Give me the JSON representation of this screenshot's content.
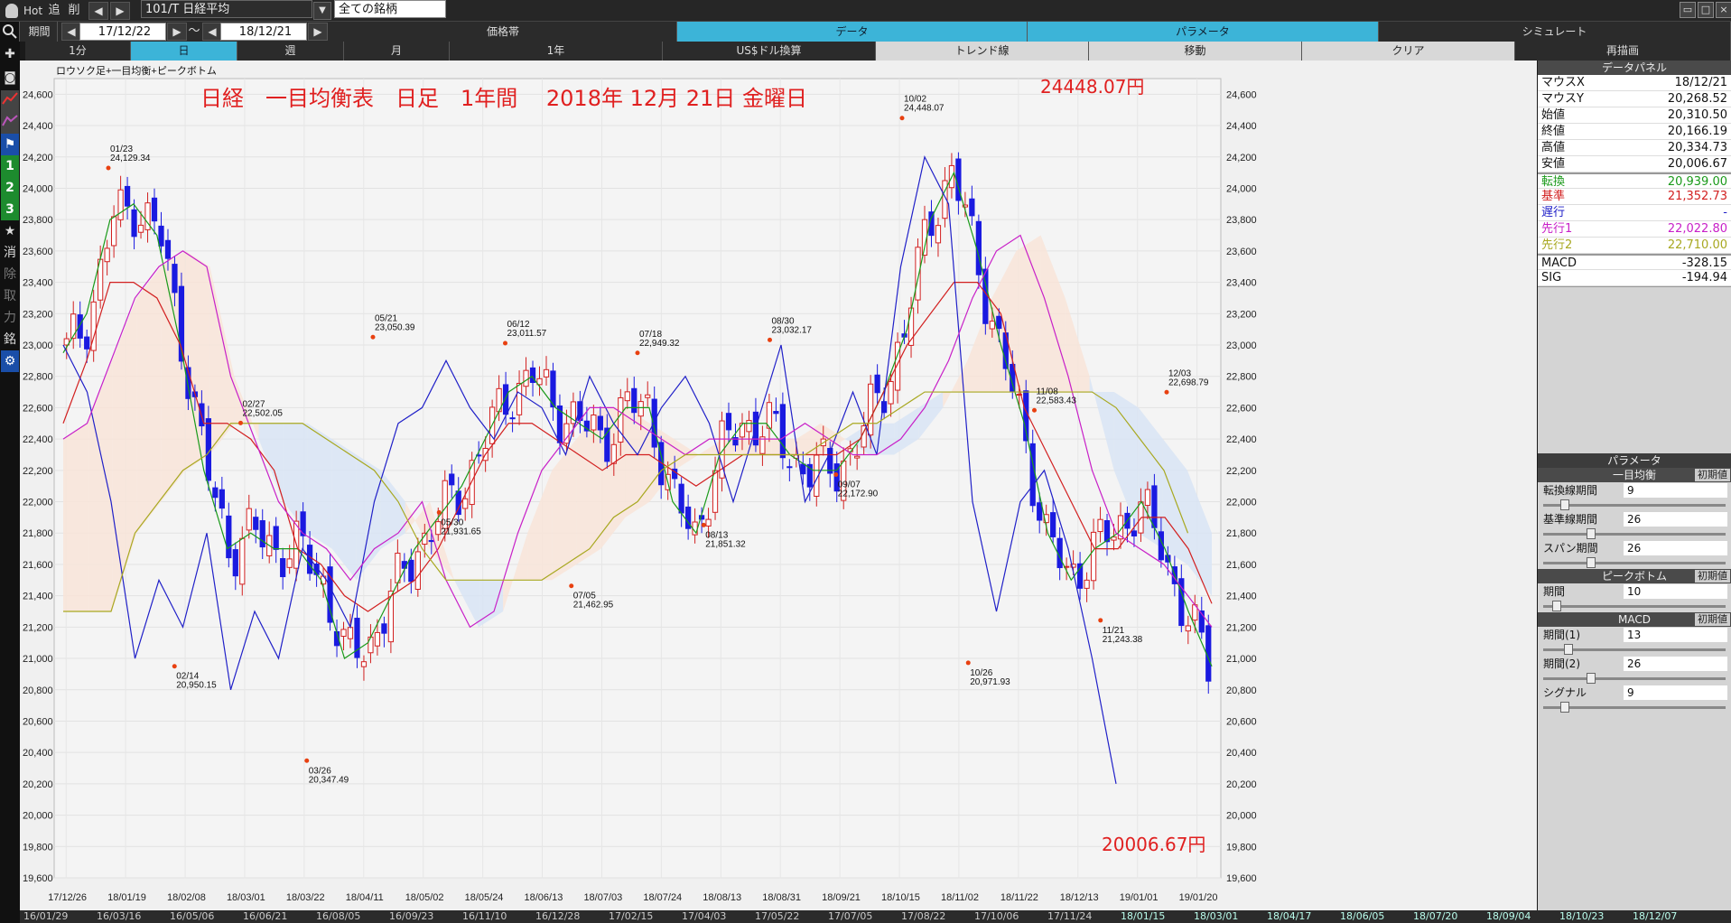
{
  "toolbar": {
    "hot": "Hot",
    "btn_tsui": "追",
    "btn_sakujo": "削",
    "symbol": "101/T 日経平均",
    "universe": "全ての銘柄"
  },
  "row2": {
    "period_label": "期間",
    "date_from": "17/12/22",
    "tilde": "～",
    "date_to": "18/12/21",
    "tabs": [
      "価格帯",
      "データ",
      "パラメータ",
      "シミュレート"
    ]
  },
  "row3": {
    "buttons": [
      "1分",
      "日",
      "週",
      "月",
      "1年",
      "US$ドル換算",
      "トレンド線",
      "移動",
      "クリア",
      "再描画"
    ]
  },
  "leftbar": {
    "items": [
      "消",
      "除",
      "取",
      "力",
      "銘"
    ]
  },
  "chart": {
    "legend": "ロウソク足+一目均衡+ピークボトム",
    "title": "日経　一目均衡表　日足　1年間　 2018年 12月 21日 金曜日",
    "high_label": "24448.07円",
    "low_label": "20006.67円"
  },
  "chart_data": {
    "type": "line",
    "title": "日経　一目均衡表　日足　1年間　 2018年 12月 21日 金曜日",
    "legend": [
      "ロウソク足",
      "一目均衡",
      "ピークボトム"
    ],
    "ylim": [
      19600,
      24700
    ],
    "yticks": [
      19600,
      19800,
      20000,
      20200,
      20400,
      20600,
      20800,
      21000,
      21200,
      21400,
      21600,
      21800,
      22000,
      22200,
      22400,
      22600,
      22800,
      23000,
      23200,
      23400,
      23600,
      23800,
      24000,
      24200,
      24400,
      24600
    ],
    "xticks": [
      "17/12/26",
      "18/01/19",
      "18/02/08",
      "18/03/01",
      "18/03/22",
      "18/04/11",
      "18/05/02",
      "18/05/24",
      "18/06/13",
      "18/07/03",
      "18/07/24",
      "18/08/13",
      "18/08/31",
      "18/09/21",
      "18/10/15",
      "18/11/02",
      "18/11/22",
      "18/12/13",
      "19/01/01",
      "19/01/20"
    ],
    "bottom_ticks": [
      "16/01/29",
      "16/03/16",
      "16/05/06",
      "16/06/21",
      "16/08/05",
      "16/09/23",
      "16/11/10",
      "16/12/28",
      "17/02/15",
      "17/04/03",
      "17/05/22",
      "17/07/05",
      "17/08/22",
      "17/10/06",
      "17/11/24",
      "18/01/15",
      "18/03/01",
      "18/04/17",
      "18/06/05",
      "18/07/20",
      "18/09/04",
      "18/10/23",
      "18/12/07"
    ],
    "grid": true,
    "peaks": [
      {
        "date": "01/23",
        "value": 24129.34,
        "type": "peak"
      },
      {
        "date": "02/14",
        "value": 20950.15,
        "type": "bottom"
      },
      {
        "date": "02/27",
        "value": 22502.05,
        "type": "peak"
      },
      {
        "date": "03/26",
        "value": 20347.49,
        "type": "bottom"
      },
      {
        "date": "05/21",
        "value": 23050.39,
        "type": "peak"
      },
      {
        "date": "05/30",
        "value": 21931.65,
        "type": "bottom"
      },
      {
        "date": "06/12",
        "value": 23011.57,
        "type": "peak"
      },
      {
        "date": "07/05",
        "value": 21462.95,
        "type": "bottom"
      },
      {
        "date": "07/18",
        "value": 22949.32,
        "type": "peak"
      },
      {
        "date": "08/13",
        "value": 21851.32,
        "type": "bottom"
      },
      {
        "date": "08/30",
        "value": 23032.17,
        "type": "peak"
      },
      {
        "date": "09/07",
        "value": 22172.9,
        "type": "bottom"
      },
      {
        "date": "10/02",
        "value": 24448.07,
        "type": "peak"
      },
      {
        "date": "10/26",
        "value": 20971.93,
        "type": "bottom"
      },
      {
        "date": "11/08",
        "value": 22583.43,
        "type": "peak"
      },
      {
        "date": "11/21",
        "value": 21243.38,
        "type": "bottom"
      },
      {
        "date": "12/03",
        "value": 22698.79,
        "type": "peak"
      }
    ],
    "series": [
      {
        "name": "転換",
        "color": "#1a9a1a",
        "values": [
          22950,
          23200,
          23800,
          23900,
          23700,
          23000,
          22200,
          21700,
          21800,
          21700,
          21700,
          21500,
          21000,
          21100,
          21400,
          21700,
          21900,
          22100,
          22400,
          22700,
          22800,
          22600,
          22500,
          22400,
          22600,
          22600,
          22000,
          21800,
          22300,
          22500,
          22500,
          22300,
          22200,
          22200,
          22400,
          22700,
          23100,
          23800,
          24100,
          23600,
          23000,
          22500,
          21800,
          21500,
          21700,
          21800,
          22000,
          21700,
          21300,
          20950
        ]
      },
      {
        "name": "基準",
        "color": "#d22020",
        "values": [
          22500,
          22900,
          23400,
          23400,
          23300,
          23000,
          22500,
          22500,
          22400,
          22200,
          21700,
          21600,
          21400,
          21300,
          21400,
          21500,
          21700,
          22000,
          22300,
          22500,
          22500,
          22400,
          22300,
          22200,
          22300,
          22300,
          22200,
          22100,
          22200,
          22300,
          22300,
          22300,
          22300,
          22300,
          22400,
          22700,
          23000,
          23200,
          23400,
          23400,
          23200,
          22600,
          22300,
          22000,
          21700,
          21700,
          21900,
          21900,
          21700,
          21350
        ]
      },
      {
        "name": "遅行",
        "color": "#2020c8",
        "values": [
          23000,
          22700,
          22000,
          21000,
          21500,
          21200,
          21800,
          20800,
          21300,
          21000,
          21700,
          21500,
          21200,
          22000,
          22500,
          22600,
          22900,
          22600,
          22400,
          22700,
          22600,
          22300,
          22800,
          22500,
          22300,
          22600,
          22800,
          22500,
          22000,
          22500,
          23000,
          22000,
          22300,
          22700,
          22300,
          23500,
          24200,
          23900,
          22000,
          21300,
          22000,
          22200,
          21700,
          21000,
          20200
        ]
      },
      {
        "name": "先行1",
        "color": "#c820c8",
        "values": [
          22400,
          22500,
          22900,
          23300,
          23500,
          23600,
          23500,
          22800,
          22400,
          22000,
          21800,
          21700,
          21500,
          21700,
          21800,
          22000,
          21500,
          21200,
          21300,
          21800,
          22200,
          22400,
          22600,
          22600,
          22500,
          22400,
          22300,
          22400,
          22400,
          22400,
          22400,
          22500,
          22400,
          22300,
          22300,
          22400,
          22600,
          22900,
          23300,
          23600,
          23700,
          23300,
          22800,
          22200,
          21800,
          21700,
          21600,
          21400,
          21200
        ]
      },
      {
        "name": "先行2",
        "color": "#a8a820",
        "values": [
          21300,
          21300,
          21300,
          21800,
          22000,
          22200,
          22300,
          22500,
          22500,
          22500,
          22500,
          22400,
          22300,
          22200,
          22000,
          21700,
          21500,
          21500,
          21500,
          21500,
          21500,
          21600,
          21700,
          21900,
          22000,
          22200,
          22300,
          22300,
          22300,
          22300,
          22300,
          22300,
          22400,
          22500,
          22500,
          22600,
          22700,
          22700,
          22700,
          22700,
          22700,
          22700,
          22700,
          22700,
          22600,
          22400,
          22200,
          21800
        ]
      }
    ]
  },
  "data_panel": {
    "title": "データパネル",
    "rows": [
      {
        "k": "マウスX",
        "v": "18/12/21",
        "color": "#111111"
      },
      {
        "k": "マウスY",
        "v": "20,268.52",
        "color": "#111111"
      },
      {
        "k": "始値",
        "v": "20,310.50",
        "color": "#111111"
      },
      {
        "k": "終値",
        "v": "20,166.19",
        "color": "#111111"
      },
      {
        "k": "高値",
        "v": "20,334.73",
        "color": "#111111"
      },
      {
        "k": "安値",
        "v": "20,006.67",
        "color": "#111111"
      },
      {
        "k": "転換",
        "v": "20,939.00",
        "color": "#1a9a1a"
      },
      {
        "k": "基準",
        "v": "21,352.73",
        "color": "#d22020"
      },
      {
        "k": "遅行",
        "v": "-",
        "color": "#2020c8"
      },
      {
        "k": "先行1",
        "v": "22,022.80",
        "color": "#c820c8"
      },
      {
        "k": "先行2",
        "v": "22,710.00",
        "color": "#a8a820"
      },
      {
        "k": "MACD",
        "v": "-328.15",
        "color": "#111111"
      },
      {
        "k": "SIG",
        "v": "-194.94",
        "color": "#111111"
      }
    ]
  },
  "param_panel": {
    "title": "パラメータ",
    "ichimoku": {
      "title": "一目均衡",
      "init": "初期値",
      "rows": [
        {
          "k": "転換線期間",
          "v": "9",
          "level": 0.1
        },
        {
          "k": "基準線期間",
          "v": "26",
          "level": 0.25
        },
        {
          "k": "スパン期間",
          "v": "26",
          "level": 0.25
        }
      ]
    },
    "peakbottom": {
      "title": "ピークボトム",
      "init": "初期値",
      "rows": [
        {
          "k": "期間",
          "v": "10",
          "level": 0.05
        }
      ]
    },
    "macd": {
      "title": "MACD",
      "init": "初期値",
      "rows": [
        {
          "k": "期間(1)",
          "v": "13",
          "level": 0.12
        },
        {
          "k": "期間(2)",
          "v": "26",
          "level": 0.25
        },
        {
          "k": "シグナル",
          "v": "9",
          "level": 0.1
        }
      ]
    }
  },
  "colors": {
    "accent": "#3cb4d8",
    "up": "#d22020",
    "down": "#1a1ae0",
    "title": "#e02020"
  }
}
